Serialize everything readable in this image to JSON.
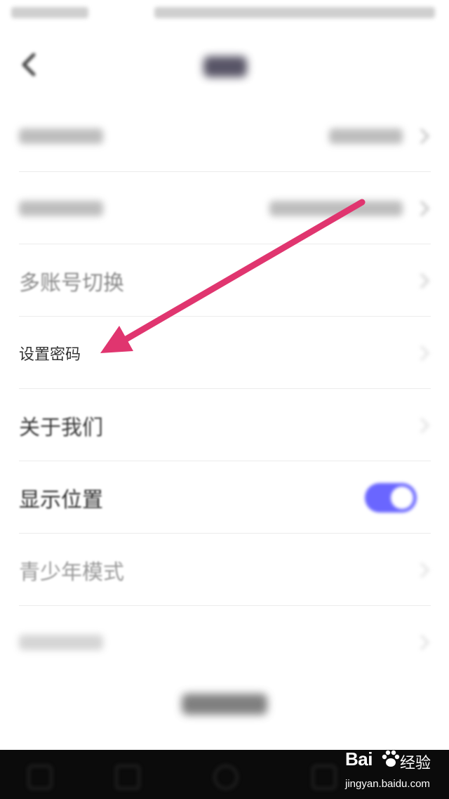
{
  "settings": {
    "items": [
      {
        "label": "多账号切换"
      },
      {
        "label": "设置密码"
      },
      {
        "label": "关于我们"
      },
      {
        "label": "显示位置",
        "toggle_on": true
      },
      {
        "label": "青少年模式"
      }
    ]
  },
  "watermark": {
    "logo_text": "Bai",
    "product_text": "经验",
    "url": "jingyan.baidu.com"
  },
  "colors": {
    "toggle_on": "#6a66ff",
    "arrow": "#e0356f"
  }
}
